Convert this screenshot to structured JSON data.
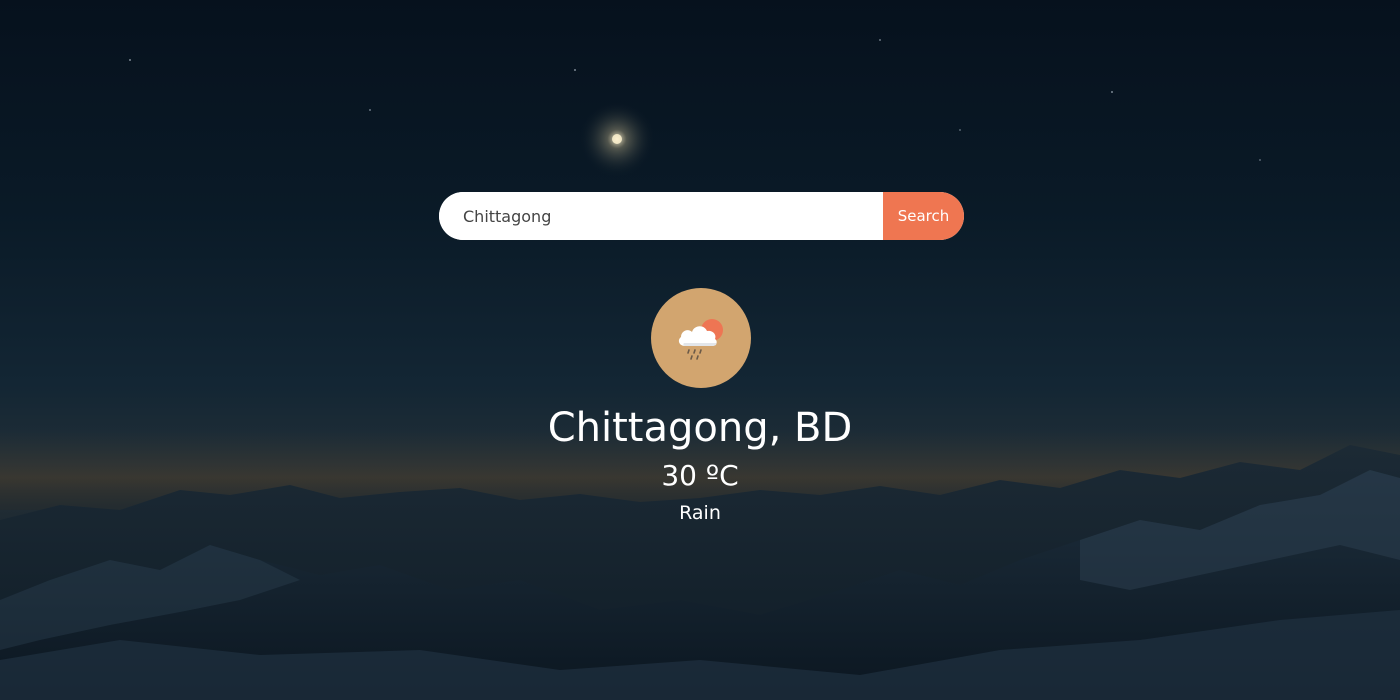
{
  "search": {
    "value": "Chittagong",
    "button_label": "Search"
  },
  "weather": {
    "icon": "cloud-rain-sun-icon",
    "location": "Chittagong, BD",
    "temperature": "30 ºC",
    "condition": "Rain"
  },
  "colors": {
    "accent": "#ef7651",
    "icon_circle": "#d2a56f"
  }
}
